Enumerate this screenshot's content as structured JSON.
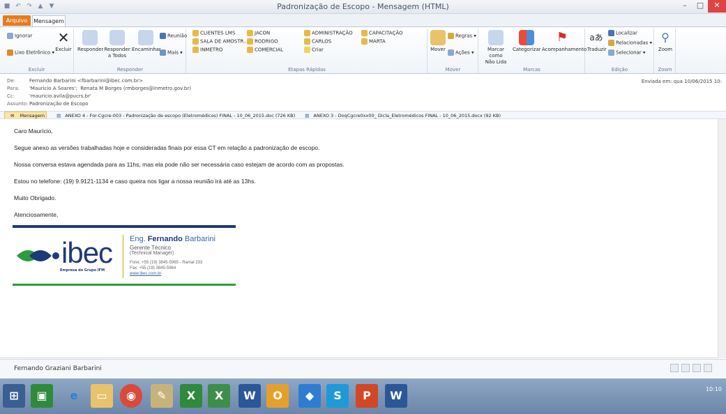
{
  "window": {
    "title": "Padronização de Escopo - Mensagem (HTML)",
    "qat_icons": [
      "save-icon",
      "undo-icon",
      "redo-icon",
      "arrow-up-icon",
      "arrow-down-icon"
    ]
  },
  "tabs": {
    "file": "Arquivo",
    "message": "Mensagem"
  },
  "ribbon": {
    "excluir": {
      "ignorar": "Ignorar",
      "lixo": "Lixo Eletrônico",
      "excluir": "Excluir",
      "label": "Excluir"
    },
    "responder": {
      "responder": "Responder",
      "responder_todos_1": "Responder",
      "responder_todos_2": "a Todos",
      "encaminhar": "Encaminhar",
      "reuniao": "Reunião",
      "mais": "Mais",
      "label": "Responder"
    },
    "etapas": {
      "items": [
        "CLIENTES LMS",
        "SALA DE AMOSTR...",
        "INMETRO",
        "JACON",
        "RODRIGO",
        "COMERCIAL",
        "ADMINISTRAÇÃO",
        "CARLOS",
        "Criar",
        "CAPACITAÇÃO",
        "MARTA"
      ],
      "label": "Etapas Rápidas"
    },
    "mover": {
      "mover": "Mover",
      "regras": "Regras",
      "acoes": "Ações",
      "label": "Mover"
    },
    "marcas": {
      "marcar_1": "Marcar como",
      "marcar_2": "Não Lida",
      "categorizar": "Categorizar",
      "acompanhamento": "Acompanhamento",
      "label": "Marcas"
    },
    "edicao": {
      "traduzir": "Traduzir",
      "localizar": "Localizar",
      "relacionadas": "Relacionadas",
      "selecionar": "Selecionar",
      "label": "Edição"
    },
    "zoom": {
      "zoom": "Zoom",
      "label": "Zoom"
    }
  },
  "header": {
    "de_label": "De:",
    "de": "Fernando Barbarini <fbarbarini@ibec.com.br>",
    "para_label": "Para:",
    "para_1": "'Mauricio A Soares';",
    "para_2": "Renata M Borges (rmborges@inmetro.gov.br)",
    "cc_label": "Cc:",
    "cc": "'mauricio.avila@pucrs.br'",
    "assunto_label": "Assunto:",
    "assunto": "Padronização de Escopo",
    "enviada_label": "Enviada em:",
    "enviada": "qua 10/06/2015 10:"
  },
  "attachments": {
    "message": "Mensagem",
    "a1": "ANEXO 4 - For-Cgcre-003 - Padronização de escopo (Eletromédicos) FINAL - 10_06_2015.doc (726 KB)",
    "a2": "ANEXO 3 - DoqCgcre0xx00_ Dicla_Eletromédicos  FINAL - 10_06_2015.docx (92 KB)"
  },
  "body": {
    "greeting": "Caro Maurício,",
    "p1": "Segue anexo as versões trabalhadas hoje e consideradas finais por essa CT em relação a padronização de escopo.",
    "p2": "Nossa conversa estava agendada para as 11hs, mas ela pode não ser necessária caso estejam de acordo com as propostas.",
    "p3": "Estou no telefone: (19) 9.9121-1134 e caso queira nos ligar a nossa reunião irá até as 13hs.",
    "p4": "Muito Obrigado.",
    "closing": "Atenciosamente,"
  },
  "signature": {
    "logo_text": "ibec",
    "logo_sub": "Empresa do Grupo IFM",
    "prefix": "Eng. ",
    "first": "Fernando",
    "last": " Barbarini",
    "role": "Gerente Técnico",
    "role_en": "(Technical Manager)",
    "fone": "Fone: +55 (19) 3845-5965 - Ramal 233",
    "fax": "Fax: +55 (19) 3845-5964",
    "web": "www.ibec.com.br"
  },
  "people_pane": {
    "name": "Fernando Graziani Barbarini"
  },
  "taskbar": {
    "items": [
      "start-icon",
      "store-icon",
      "ie-icon",
      "explorer-icon",
      "chrome-icon",
      "paint-icon",
      "excel-icon",
      "excel-icon",
      "word-icon",
      "outlook-icon",
      "dropbox-icon",
      "skype-icon",
      "powerpoint-icon",
      "word-icon"
    ],
    "clock": "10:10"
  }
}
